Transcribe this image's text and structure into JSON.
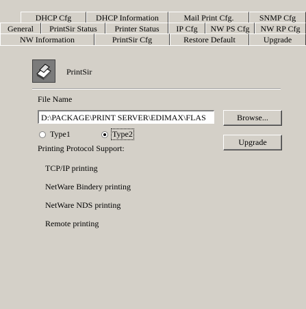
{
  "tabs": {
    "row1": [
      "DHCP Cfg",
      "DHCP Information",
      "Mail Print Cfg.",
      "SNMP Cfg"
    ],
    "row2": [
      "General",
      "PrintSir Status",
      "Printer Status",
      "IP Cfg",
      "NW PS Cfg",
      "NW RP Cfg"
    ],
    "row3": [
      "NW Information",
      "PrintSir Cfg",
      "Restore Default",
      "Upgrade"
    ],
    "active": "Upgrade"
  },
  "device": {
    "name": "PrintSir",
    "icon": "printer-icon"
  },
  "upgrade": {
    "file_name_label": "File Name",
    "file_path": "D:\\PACKAGE\\PRINT SERVER\\EDIMAX\\FLAS",
    "browse_label": "Browse...",
    "upgrade_label": "Upgrade",
    "type1_label": "Type1",
    "type2_label": "Type2",
    "selected_type": "Type2"
  },
  "protocols": {
    "heading": "Printing Protocol Support:",
    "items": [
      "TCP/IP printing",
      "NetWare Bindery printing",
      "NetWare NDS printing",
      "Remote printing"
    ]
  }
}
